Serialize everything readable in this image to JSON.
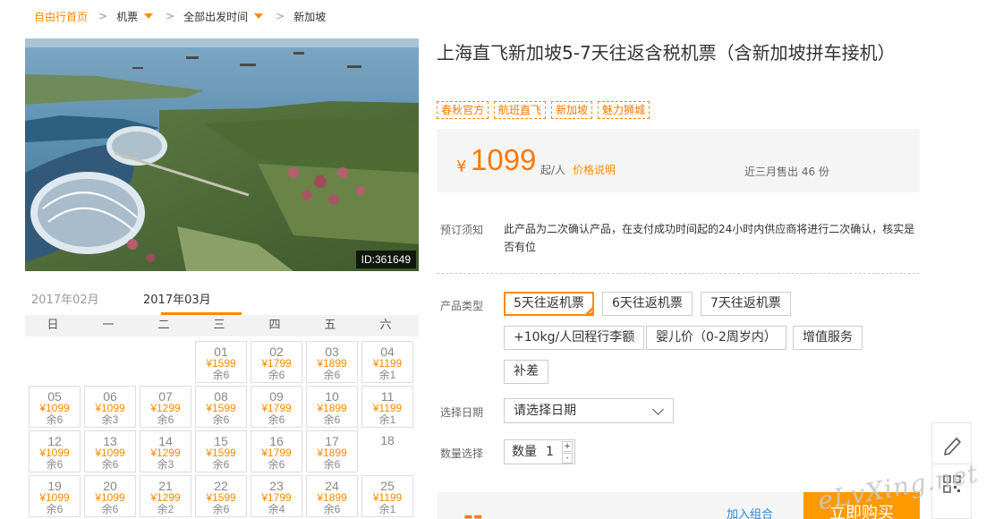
{
  "breadcrumb": {
    "home": "自由行首页",
    "items": [
      "机票",
      "全部出发时间",
      "新加坡"
    ]
  },
  "photo": {
    "id_label": "ID:361649"
  },
  "calendar": {
    "months": [
      "2017年02月",
      "2017年03月"
    ],
    "active_month": "2017年03月",
    "weekdays": [
      "日",
      "一",
      "二",
      "三",
      "四",
      "五",
      "六"
    ],
    "weeks": [
      [
        null,
        null,
        null,
        {
          "day": "01",
          "price": "¥1599",
          "left": "余6"
        },
        {
          "day": "02",
          "price": "¥1799",
          "left": "余6"
        },
        {
          "day": "03",
          "price": "¥1899",
          "left": "余6"
        },
        {
          "day": "04",
          "price": "¥1199",
          "left": "余1"
        }
      ],
      [
        {
          "day": "05",
          "price": "¥1099",
          "left": "余6"
        },
        {
          "day": "06",
          "price": "¥1099",
          "left": "余3"
        },
        {
          "day": "07",
          "price": "¥1299",
          "left": "余6"
        },
        {
          "day": "08",
          "price": "¥1599",
          "left": "余6"
        },
        {
          "day": "09",
          "price": "¥1799",
          "left": "余6"
        },
        {
          "day": "10",
          "price": "¥1899",
          "left": "余6"
        },
        {
          "day": "11",
          "price": "¥1199",
          "left": "余1"
        }
      ],
      [
        {
          "day": "12",
          "price": "¥1099",
          "left": "余6"
        },
        {
          "day": "13",
          "price": "¥1099",
          "left": "余6"
        },
        {
          "day": "14",
          "price": "¥1299",
          "left": "余3"
        },
        {
          "day": "15",
          "price": "¥1599",
          "left": "余6"
        },
        {
          "day": "16",
          "price": "¥1799",
          "left": "余6"
        },
        {
          "day": "17",
          "price": "¥1899",
          "left": "余6"
        },
        {
          "day": "18",
          "price": "",
          "left": ""
        }
      ],
      [
        {
          "day": "19",
          "price": "¥1099",
          "left": "余6"
        },
        {
          "day": "20",
          "price": "¥1099",
          "left": "余6"
        },
        {
          "day": "21",
          "price": "¥1299",
          "left": "余2"
        },
        {
          "day": "22",
          "price": "¥1599",
          "left": "余6"
        },
        {
          "day": "23",
          "price": "¥1799",
          "left": "余4"
        },
        {
          "day": "24",
          "price": "¥1899",
          "left": "余6"
        },
        {
          "day": "25",
          "price": "¥1199",
          "left": "余1"
        }
      ]
    ]
  },
  "product": {
    "title": "上海直飞新加坡5-7天往返含税机票（含新加坡拼车接机）",
    "tags": [
      "春秋官方",
      "航班直飞",
      "新加坡",
      "魅力狮城"
    ],
    "price_symbol": "¥",
    "price": "1099",
    "price_unit": "起/人",
    "price_explain": "价格说明",
    "sold": "近三月售出 46 份"
  },
  "booking": {
    "notice_label": "预订须知",
    "notice_text": "此产品为二次确认产品，在支付成功时间起的24小时内供应商将进行二次确认，核实是否有位",
    "type_label": "产品类型",
    "types": [
      "5天往返机票",
      "6天往返机票",
      "7天往返机票",
      "+10kg/人回程行李额",
      "婴儿价（0-2周岁内）",
      "增值服务",
      "补差"
    ],
    "selected_type": "5天往返机票",
    "date_label": "选择日期",
    "date_placeholder": "请选择日期",
    "qty_label": "数量选择",
    "qty_text": "数量",
    "qty_value": "1",
    "plus": "+",
    "minus": "-",
    "total_dash": "--",
    "add_combo": "加入组合",
    "buy_now": "立即购买"
  },
  "watermark": "eLvXing.net",
  "colors": {
    "accent": "#ff8a00",
    "buy": "#ff9900",
    "link": "#2a8bd6"
  }
}
